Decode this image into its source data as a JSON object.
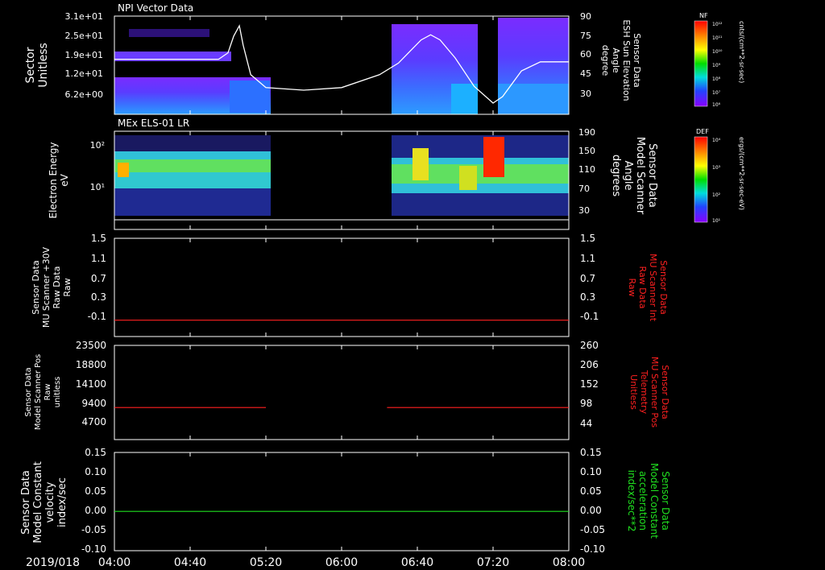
{
  "time_axis": {
    "date": "2019/018",
    "ticks": [
      "04:00",
      "04:40",
      "05:20",
      "06:00",
      "06:40",
      "07:20",
      "08:00"
    ]
  },
  "colors": {
    "background": "#000000",
    "axis": "#ffffff",
    "red_trace": "#ff2020",
    "green_trace": "#20e020"
  },
  "chart_data": [
    {
      "type": "heatmap",
      "id": "p1",
      "title": "NPI Vector Data",
      "ylabel_lines": [
        "Sector",
        "Unitless"
      ],
      "yticks": [
        "3.1e+01",
        "2.5e+01",
        "1.9e+01",
        "1.2e+01",
        "6.2e+00"
      ],
      "right_ylabel_lines": [
        "Sensor Data",
        "ESH Sun Elevation",
        "Angle",
        "degree"
      ],
      "right_yticks": [
        "90",
        "75",
        "60",
        "45",
        "30"
      ],
      "data_gap": [
        "05:21",
        "06:23"
      ],
      "line_series": {
        "name": "ESH Sun Elevation Angle",
        "x": [
          "04:00",
          "04:55",
          "05:00",
          "05:03",
          "05:06",
          "05:08",
          "05:12",
          "05:20",
          "05:40",
          "06:00",
          "06:20",
          "06:30",
          "06:42",
          "06:47",
          "06:52",
          "07:00",
          "07:10",
          "07:20",
          "07:25",
          "07:35",
          "07:45",
          "08:00"
        ],
        "y": [
          59,
          59,
          64,
          77,
          85,
          70,
          47,
          37,
          35,
          37,
          47,
          56,
          74,
          78,
          74,
          60,
          38,
          25,
          30,
          50,
          57,
          57
        ]
      },
      "colorbar": {
        "label": "NF",
        "units": "cnts/(cm**2-sr-sec)",
        "ticks": [
          "10¹²",
          "10¹¹",
          "10¹⁰",
          "10⁹",
          "10⁸",
          "10⁷",
          "10⁶"
        ]
      }
    },
    {
      "type": "heatmap",
      "id": "p2",
      "title": "MEx ELS-01 LR",
      "ylabel_lines": [
        "Electron Energy",
        "eV"
      ],
      "yticks": [
        "10²",
        "10¹"
      ],
      "right_ylabel_lines": [
        "Sensor Data",
        "Model Scanner",
        "Angle",
        "degrees"
      ],
      "right_yticks": [
        "190",
        "150",
        "110",
        "70",
        "30"
      ],
      "data_gap": [
        "05:21",
        "06:23"
      ],
      "colorbar": {
        "label": "DEF",
        "units": "ergs/(cm**2-sr-sec-eV)",
        "ticks": [
          "10⁴",
          "10³",
          "10²",
          "10¹"
        ]
      }
    },
    {
      "type": "line",
      "id": "p3",
      "ylabel_lines": [
        "Sensor Data",
        "MU Scanner +30V",
        "Raw Data",
        "Raw"
      ],
      "yticks": [
        "1.5",
        "1.1",
        "0.7",
        "0.3",
        "-0.1"
      ],
      "right_ylabel_lines": [
        "Sensor Data",
        "MU Scanner Int",
        "Raw Data",
        "Raw"
      ],
      "right_yticks": [
        "1.5",
        "1.1",
        "0.7",
        "0.3",
        "-0.1"
      ],
      "ylim": [
        -0.3,
        1.5
      ],
      "series": [
        {
          "color": "#ff2020",
          "x": [
            "04:00",
            "08:00"
          ],
          "y": [
            0,
            0
          ]
        }
      ]
    },
    {
      "type": "line",
      "id": "p4",
      "ylabel_lines": [
        "Sensor Data",
        "Model Scanner Pos",
        "Raw",
        "unitless"
      ],
      "yticks": [
        "23500",
        "18800",
        "14100",
        "9400",
        "4700"
      ],
      "right_ylabel_lines": [
        "Sensor Data",
        "MU Scanner Pos",
        "Telemetry",
        "Unitless"
      ],
      "right_yticks": [
        "260",
        "206",
        "152",
        "98",
        "44"
      ],
      "ylim": [
        0,
        23500
      ],
      "series": [
        {
          "color": "#ff2020",
          "x": [
            "04:00",
            "05:20"
          ],
          "y": [
            8000,
            8000
          ]
        },
        {
          "color": "#ff2020",
          "x": [
            "06:24",
            "08:00"
          ],
          "y": [
            8000,
            8000
          ]
        }
      ]
    },
    {
      "type": "line",
      "id": "p5",
      "ylabel_lines": [
        "Sensor Data",
        "Model Constant",
        "velocity",
        "index/sec"
      ],
      "yticks": [
        "0.15",
        "0.10",
        "0.05",
        "0.00",
        "-0.05",
        "-0.10"
      ],
      "right_ylabel_lines": [
        "Sensor Data",
        "Model Constant",
        "acceleration",
        "index/sec**2"
      ],
      "right_yticks": [
        "0.15",
        "0.10",
        "0.05",
        "0.00",
        "-0.05",
        "-0.10"
      ],
      "ylim": [
        -0.1,
        0.15
      ],
      "series": [
        {
          "color": "#20e020",
          "x": [
            "04:00",
            "08:00"
          ],
          "y": [
            0,
            0
          ]
        }
      ]
    }
  ]
}
